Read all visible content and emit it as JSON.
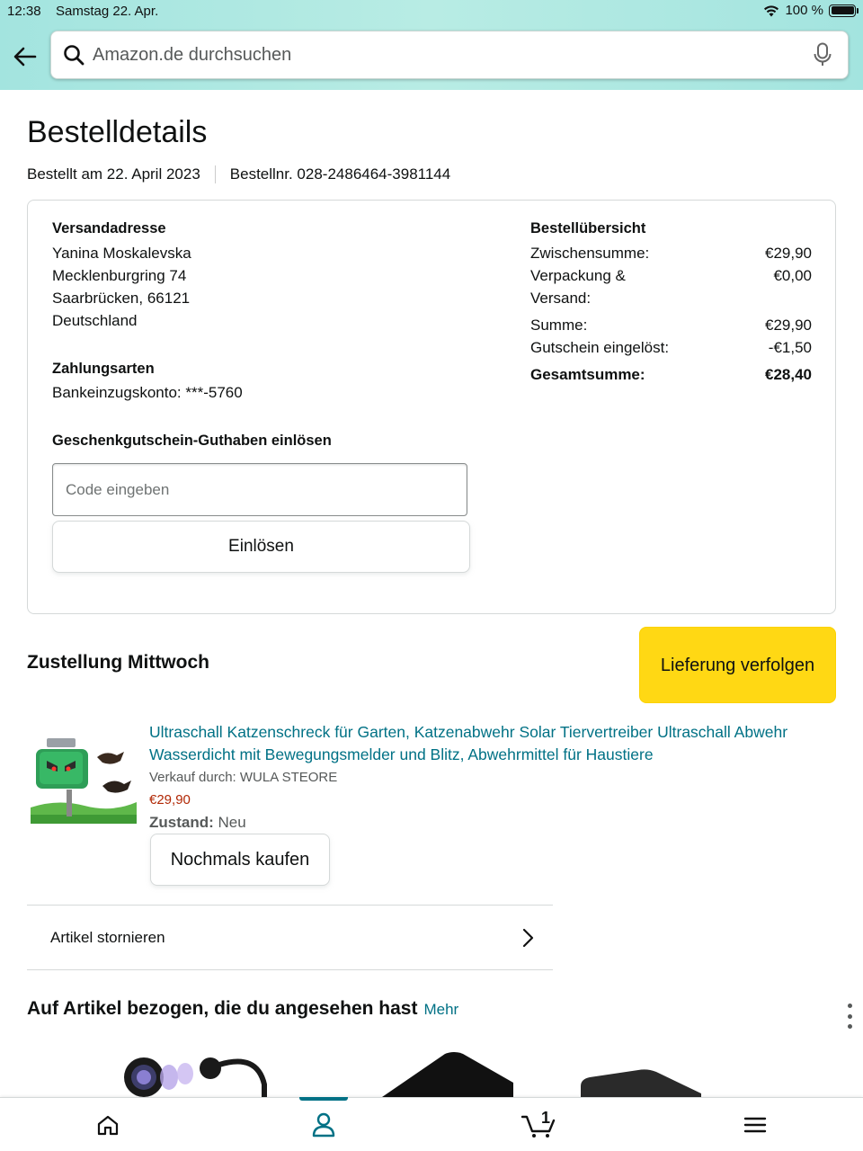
{
  "status_bar": {
    "time": "12:38",
    "date": "Samstag 22. Apr.",
    "battery": "100 %"
  },
  "search": {
    "placeholder": "Amazon.de durchsuchen"
  },
  "page": {
    "title": "Bestelldetails",
    "ordered_on": "Bestellt am 22. April 2023",
    "order_number": "Bestellnr. 028-2486464-3981144"
  },
  "shipping": {
    "heading": "Versandadresse",
    "lines": [
      "Yanina Moskalevska",
      "Mecklenburgring 74",
      "Saarbrücken, 66121",
      "Deutschland"
    ]
  },
  "payment": {
    "heading": "Zahlungsarten",
    "method": "Bankeinzugskonto: ***-5760"
  },
  "gift": {
    "heading": "Geschenkgutschein-Guthaben einlösen",
    "placeholder": "Code eingeben",
    "button": "Einlösen"
  },
  "summary": {
    "heading": "Bestellübersicht",
    "subtotal_label": "Zwischensumme:",
    "subtotal_value": "€29,90",
    "shipping_label": "Verpackung & Versand:",
    "shipping_value": "€0,00",
    "sum_label": "Summe:",
    "sum_value": "€29,90",
    "voucher_label": "Gutschein eingelöst:",
    "voucher_value": "-€1,50",
    "total_label": "Gesamtsumme:",
    "total_value": "€28,40"
  },
  "delivery": {
    "heading": "Zustellung Mittwoch",
    "track_button": "Lieferung verfolgen"
  },
  "product": {
    "title": "Ultraschall Katzenschreck für Garten, Katzenabwehr Solar Tiervertreiber Ultraschall Abwehr Wasserdicht mit Bewegungsmelder und Blitz, Abwehrmittel für Haustiere",
    "seller": "Verkauf durch: WULA STEORE",
    "price": "€29,90",
    "condition_label": "Zustand:",
    "condition_value": "Neu",
    "rebuy_button": "Nochmals kaufen"
  },
  "cancel": {
    "label": "Artikel stornieren"
  },
  "related": {
    "heading": "Auf Artikel bezogen, die du angesehen hast",
    "more": "Mehr"
  },
  "bottom_nav": {
    "cart_count": "1"
  },
  "colors": {
    "accent": "#007185",
    "button_yellow": "#ffd814",
    "price_red": "#b12704",
    "header_teal": "#a3e4df"
  }
}
